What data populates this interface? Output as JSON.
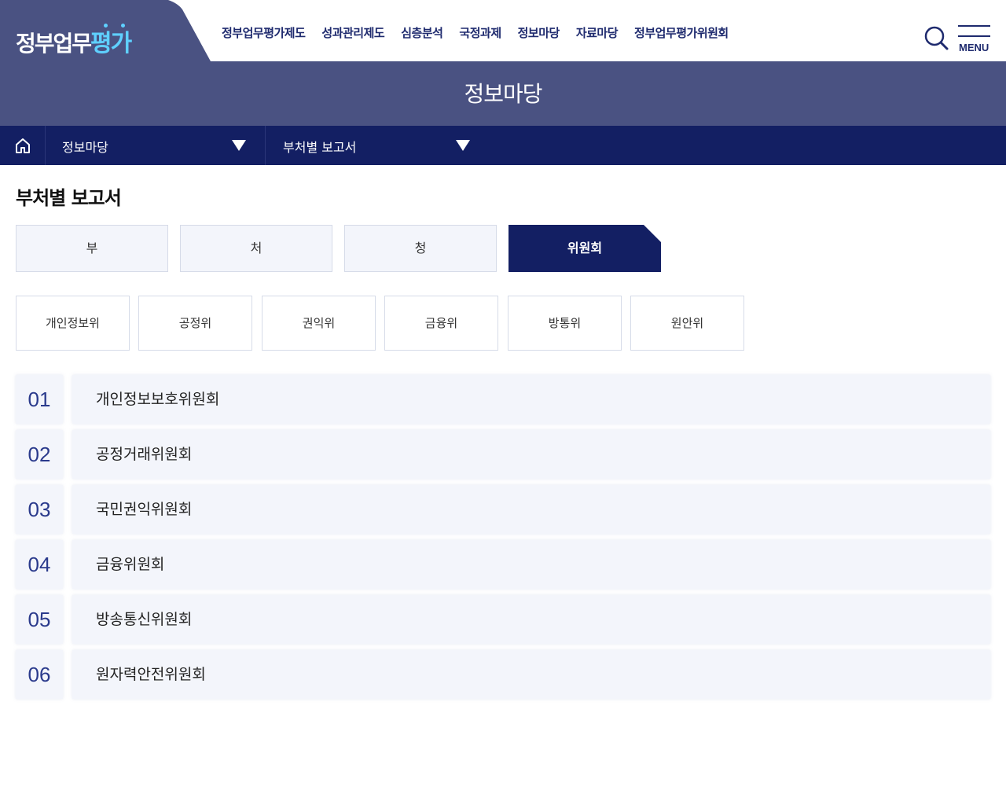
{
  "header": {
    "logo_main": "정부업무",
    "logo_accent": "평가",
    "nav": [
      "정부업무평가제도",
      "성과관리제도",
      "심층분석",
      "국정과제",
      "정보마당",
      "자료마당",
      "정부업무평가위원회"
    ],
    "menu_label": "MENU"
  },
  "banner": {
    "title": "정보마당"
  },
  "location": {
    "level1": "정보마당",
    "level2": "부처별 보고서"
  },
  "page": {
    "heading": "부처별 보고서"
  },
  "tabs": [
    "부",
    "처",
    "청",
    "위원회"
  ],
  "active_tab": "위원회",
  "subtabs": [
    "개인정보위",
    "공정위",
    "권익위",
    "금융위",
    "방통위",
    "원안위"
  ],
  "list": [
    {
      "num": "01",
      "name": "개인정보보호위원회"
    },
    {
      "num": "02",
      "name": "공정거래위원회"
    },
    {
      "num": "03",
      "name": "국민권익위원회"
    },
    {
      "num": "04",
      "name": "금융위원회"
    },
    {
      "num": "05",
      "name": "방송통신위원회"
    },
    {
      "num": "06",
      "name": "원자력안전위원회"
    }
  ],
  "colors": {
    "navy": "#131f63",
    "banner": "#4a5282",
    "accent": "#5fd0ff",
    "number": "#2a3a8c"
  }
}
